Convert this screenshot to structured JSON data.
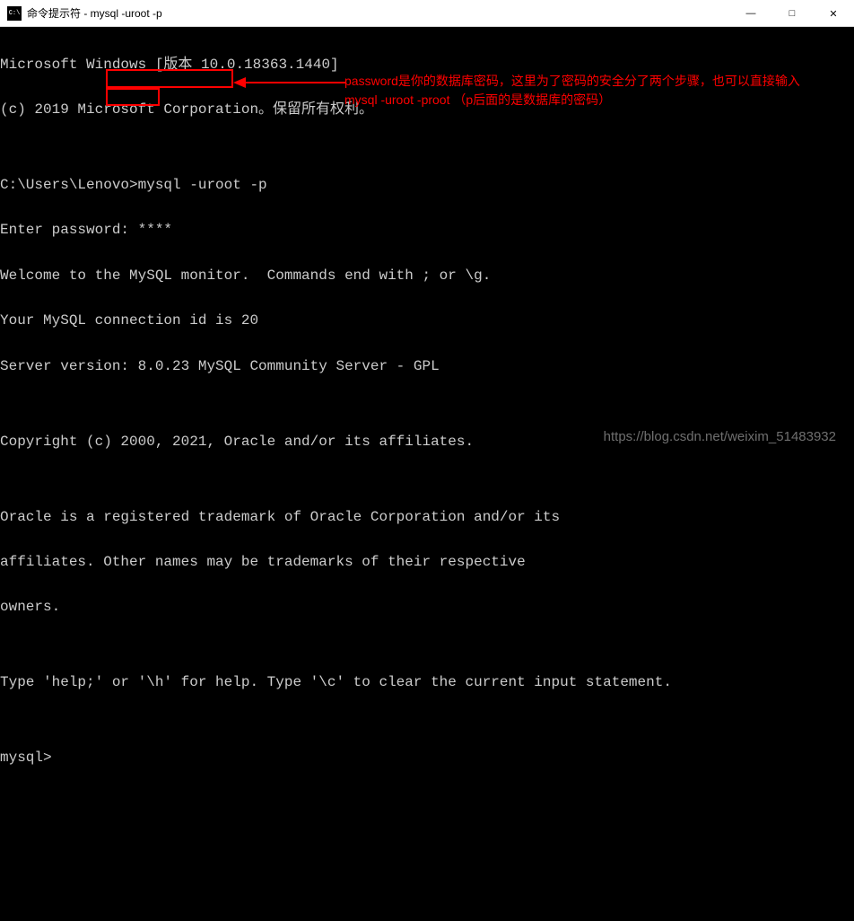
{
  "title_bar": {
    "icon_label": "C:\\",
    "title": "命令提示符 - mysql  -uroot -p",
    "minimize": "—",
    "maximize": "□",
    "close": "✕"
  },
  "terminal": {
    "lines": [
      "Microsoft Windows [版本 10.0.18363.1440]",
      "(c) 2019 Microsoft Corporation。保留所有权利。",
      "",
      "C:\\Users\\Lenovo>mysql -uroot -p",
      "Enter password: ****",
      "Welcome to the MySQL monitor.  Commands end with ; or \\g.",
      "Your MySQL connection id is 20",
      "Server version: 8.0.23 MySQL Community Server - GPL",
      "",
      "Copyright (c) 2000, 2021, Oracle and/or its affiliates.",
      "",
      "Oracle is a registered trademark of Oracle Corporation and/or its",
      "affiliates. Other names may be trademarks of their respective",
      "owners.",
      "",
      "Type 'help;' or '\\h' for help. Type '\\c' to clear the current input statement.",
      "",
      "mysql>"
    ]
  },
  "annotations": {
    "text_line1": "password是你的数据库密码，这里为了密码的安全分了两个步骤，也可以直接输入",
    "text_line2": "mysql -uroot -proot    （p后面的是数据库的密码）"
  },
  "watermark": "https://blog.csdn.net/weixim_51483932"
}
